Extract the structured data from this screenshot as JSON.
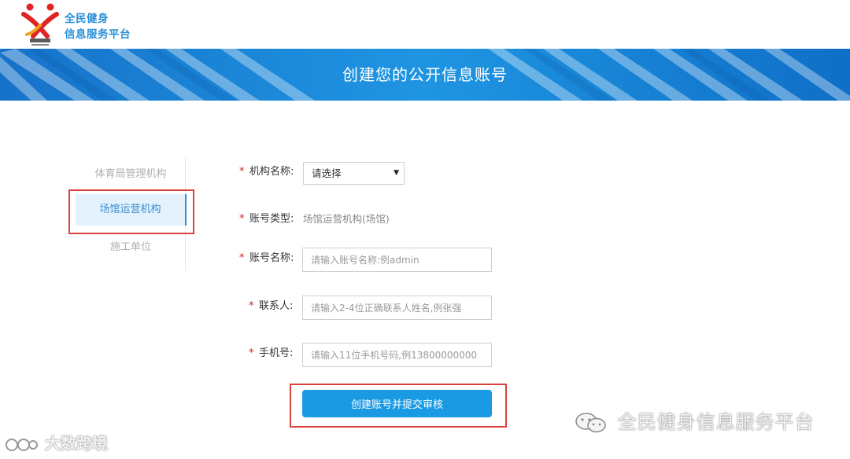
{
  "header": {
    "logo_line1": "全民健身",
    "logo_line2": "信息服务平台"
  },
  "banner": {
    "title": "创建您的公开信息账号"
  },
  "type_nav": {
    "items": [
      {
        "label": "体育局管理机构",
        "active": false
      },
      {
        "label": "场馆运营机构",
        "active": true
      },
      {
        "label": "施工单位",
        "active": false
      }
    ]
  },
  "form": {
    "required_mark": "*",
    "org_name": {
      "label": "机构名称:",
      "selected": "请选择"
    },
    "account_type": {
      "label": "账号类型:",
      "value": "场馆运营机构(场馆)"
    },
    "account_name": {
      "label": "账号名称:",
      "value": "",
      "placeholder": "请输入账号名称:例admin"
    },
    "contact": {
      "label": "联系人:",
      "value": "",
      "placeholder": "请输入2-4位正确联系人姓名,例张强"
    },
    "phone": {
      "label": "手机号:",
      "value": "",
      "placeholder": "请输入11位手机号码,例13800000000"
    },
    "submit_label": "创建账号并提交审核"
  },
  "watermarks": {
    "left": "大数跨境",
    "right": "全民健身信息服务平台"
  },
  "colors": {
    "brand_blue": "#2a8fd6",
    "button_blue": "#1a9ae3",
    "required_red": "#d81e1e",
    "highlight_red": "#d94040",
    "active_bg": "#e3f2fc"
  }
}
